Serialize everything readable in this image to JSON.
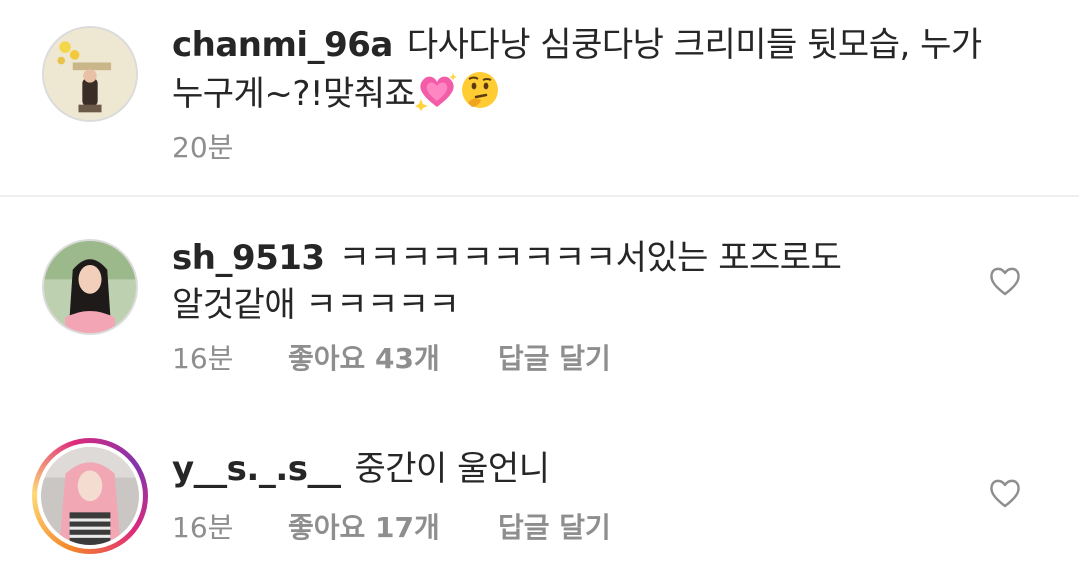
{
  "comments": [
    {
      "username": "chanmi_96a",
      "text_line1": "다사다낭 심쿵다낭 크리미들 뒷모습, 누가",
      "text_line2": "누구게~?!맞춰죠",
      "emojis": [
        "sparkling-heart-icon",
        "thinking-face-icon"
      ],
      "time": "20분"
    },
    {
      "username": "sh_9513",
      "text_line1": "ㅋㅋㅋㅋㅋㅋㅋㅋㅋ서있는 포즈로도",
      "text_line2": "알것같애 ㅋㅋㅋㅋㅋ",
      "time": "16분",
      "likes": "좋아요 43개",
      "reply": "답글 달기"
    },
    {
      "username": "y__s._.s__",
      "text_line1": "중간이 울언니",
      "time": "16분",
      "likes": "좋아요 17개",
      "reply": "답글 달기"
    }
  ],
  "colors": {
    "text": "#262626",
    "meta": "#8e8e8e",
    "divider": "#efefef",
    "heart_outline": "#8e8e8e"
  }
}
